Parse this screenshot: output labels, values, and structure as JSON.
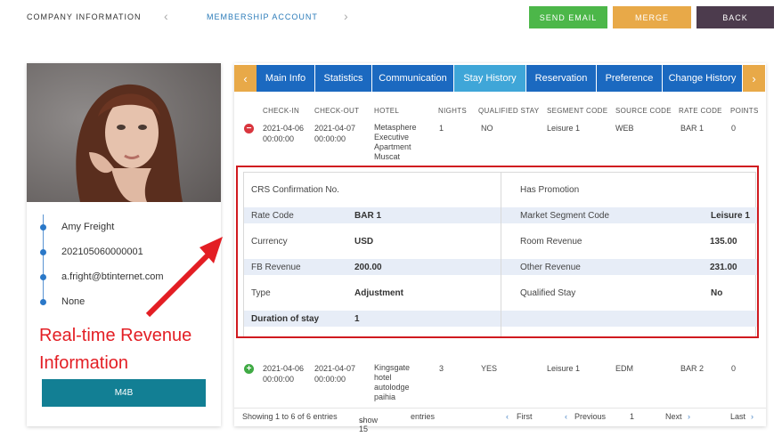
{
  "topbar": {
    "company_info": "COMPANY INFORMATION",
    "membership": "MEMBERSHIP ACCOUNT",
    "send_email": "SEND EMAIL",
    "merge": "MERGE",
    "back": "BACK"
  },
  "profile": {
    "name": "Amy Freight",
    "id": "202105060000001",
    "email": "a.fright@btinternet.com",
    "extra": "None",
    "button": "M4B"
  },
  "annotation": {
    "line1": "Real-time Revenue",
    "line2": "Information"
  },
  "tabs": [
    "Main Info",
    "Statistics",
    "Communication",
    "Stay History",
    "Reservation",
    "Preference",
    "Change History"
  ],
  "table": {
    "headers": [
      "CHECK-IN",
      "CHECK-OUT",
      "HOTEL",
      "NIGHTS",
      "QUALIFIED STAY",
      "SEGMENT CODE",
      "SOURCE CODE",
      "RATE CODE",
      "POINTS"
    ],
    "rows": [
      {
        "checkin_date": "2021-04-06",
        "checkin_time": "00:00:00",
        "checkout_date": "2021-04-07",
        "checkout_time": "00:00:00",
        "hotel": [
          "Metasphere",
          "Executive",
          "Apartment",
          "Muscat"
        ],
        "nights": "1",
        "qualified": "NO",
        "segment": "Leisure 1",
        "source": "WEB",
        "rate": "BAR 1",
        "points": "0",
        "toggle": "−"
      },
      {
        "checkin_date": "2021-04-06",
        "checkin_time": "00:00:00",
        "checkout_date": "2021-04-07",
        "checkout_time": "00:00:00",
        "hotel": [
          "Kingsgate",
          "hotel",
          "autolodge",
          "paihia"
        ],
        "nights": "3",
        "qualified": "YES",
        "segment": "Leisure 1",
        "source": "EDM",
        "rate": "BAR 2",
        "points": "0",
        "toggle": "+"
      }
    ]
  },
  "detail": {
    "crs_label": "CRS Confirmation No.",
    "has_promotion_label": "Has Promotion",
    "rate_code_label": "Rate Code",
    "rate_code": "BAR 1",
    "market_segment_label": "Market Segment Code",
    "market_segment": "Leisure 1",
    "currency_label": "Currency",
    "currency": "USD",
    "room_revenue_label": "Room Revenue",
    "room_revenue": "135.00",
    "fb_revenue_label": "FB Revenue",
    "fb_revenue": "200.00",
    "other_revenue_label": "Other Revenue",
    "other_revenue": "231.00",
    "type_label": "Type",
    "type": "Adjustment",
    "qualified_stay_label": "Qualified Stay",
    "qualified_stay": "No",
    "duration_label": "Duration of stay",
    "duration": "1"
  },
  "footer": {
    "showing": "Showing 1 to 6 of 6 entries",
    "show": "show 15",
    "entries": "entries",
    "first": "First",
    "previous": "Previous",
    "page": "1",
    "next": "Next",
    "last": "Last"
  },
  "colors": {
    "tab_blue": "#1b69c0",
    "tab_active": "#3fa6d8",
    "orange": "#e8a948",
    "green": "#4cb749",
    "dark": "#4c3b4d",
    "teal": "#127f94",
    "annotation_red": "#e31e24"
  }
}
